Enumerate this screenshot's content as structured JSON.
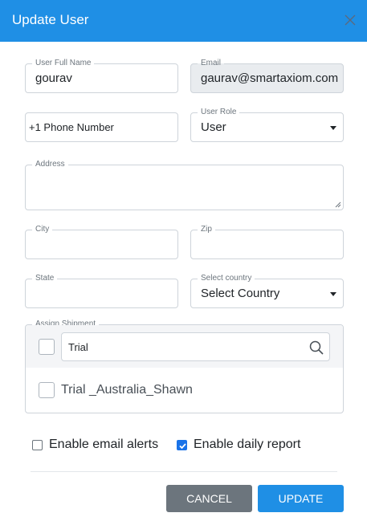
{
  "modal": {
    "title": "Update User"
  },
  "form": {
    "full_name": {
      "label": "User Full Name",
      "value": "gourav"
    },
    "email": {
      "label": "Email",
      "value": "gaurav@smartaxiom.com"
    },
    "phone": {
      "placeholder": "+1 Phone Number"
    },
    "role": {
      "label": "User Role",
      "value": "User"
    },
    "address": {
      "label": "Address",
      "value": ""
    },
    "city": {
      "label": "City",
      "value": ""
    },
    "zip": {
      "label": "Zip",
      "value": ""
    },
    "state": {
      "label": "State",
      "value": ""
    },
    "country": {
      "label": "Select country",
      "value": "Select Country"
    }
  },
  "shipment": {
    "label": "Assign Shipment",
    "search_value": "Trial",
    "items": [
      {
        "label": "Trial _Australia_Shawn",
        "checked": false
      }
    ]
  },
  "options": {
    "email_alerts": {
      "label": "Enable email alerts",
      "checked": false
    },
    "daily_report": {
      "label": "Enable daily report",
      "checked": true
    }
  },
  "buttons": {
    "cancel": "CANCEL",
    "update": "UPDATE"
  },
  "colors": {
    "header": "#1f8fe5",
    "primary_button": "#1f8fe5",
    "secondary_button": "#6c757d",
    "checkbox_checked": "#1a73e8"
  },
  "icons": {
    "close": "close-icon",
    "search": "search-icon",
    "dropdown": "chevron-down-icon",
    "check": "check-icon"
  }
}
